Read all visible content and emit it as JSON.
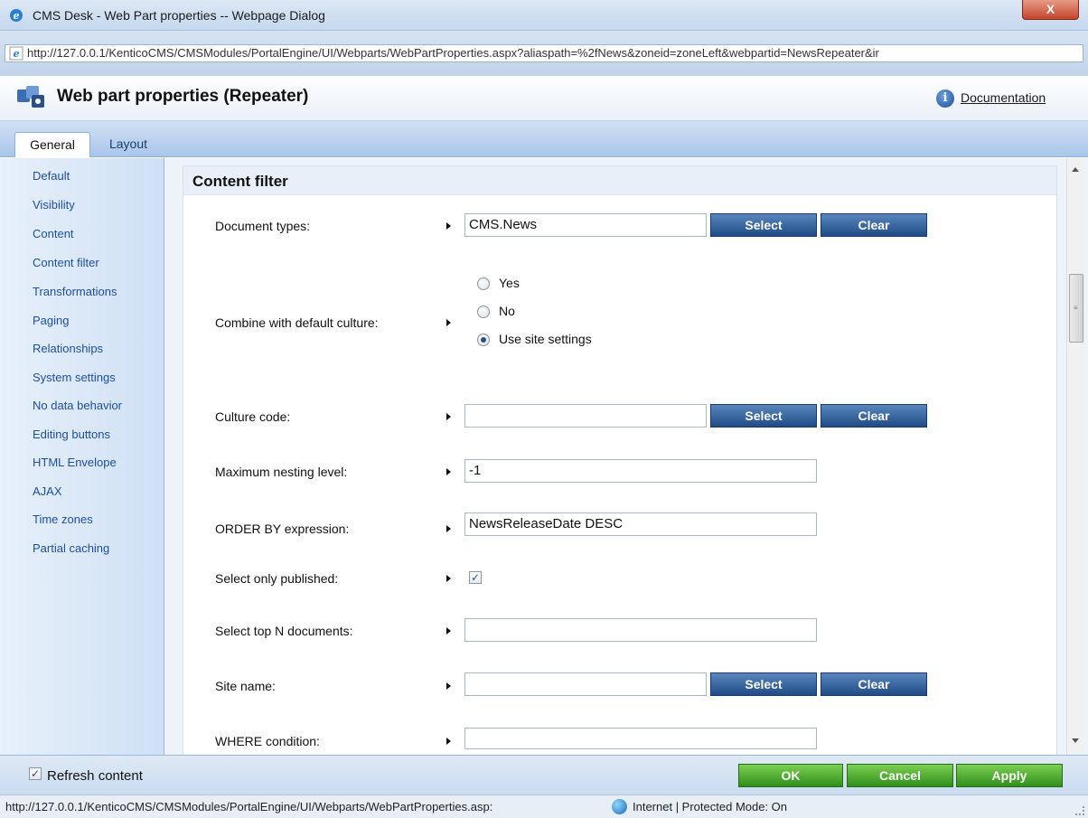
{
  "window": {
    "title": "CMS Desk - Web Part properties -- Webpage Dialog",
    "close_label": "X"
  },
  "address": {
    "url": "http://127.0.0.1/KenticoCMS/CMSModules/PortalEngine/UI/Webparts/WebPartProperties.aspx?aliaspath=%2fNews&zoneid=zoneLeft&webpartid=NewsRepeater&ir"
  },
  "header": {
    "title": "Web part properties (Repeater)",
    "doc_link": "Documentation",
    "info_glyph": "i"
  },
  "tabs": [
    {
      "label": "General",
      "active": true
    },
    {
      "label": "Layout",
      "active": false
    }
  ],
  "sidebar": {
    "items": [
      "Default",
      "Visibility",
      "Content",
      "Content filter",
      "Transformations",
      "Paging",
      "Relationships",
      "System settings",
      "No data behavior",
      "Editing buttons",
      "HTML Envelope",
      "AJAX",
      "Time zones",
      "Partial caching"
    ]
  },
  "section": {
    "title": "Content filter"
  },
  "form": {
    "document_types": {
      "label": "Document types:",
      "value": "CMS.News",
      "select_label": "Select",
      "clear_label": "Clear"
    },
    "combine_culture": {
      "label": "Combine with default culture:",
      "options": [
        "Yes",
        "No",
        "Use site settings"
      ],
      "selected": "Use site settings"
    },
    "culture_code": {
      "label": "Culture code:",
      "value": "",
      "select_label": "Select",
      "clear_label": "Clear"
    },
    "max_nesting": {
      "label": "Maximum nesting level:",
      "value": "-1"
    },
    "order_by": {
      "label": "ORDER BY expression:",
      "value": "NewsReleaseDate DESC"
    },
    "select_published": {
      "label": "Select only published:",
      "checked": true
    },
    "top_n": {
      "label": "Select top N documents:",
      "value": ""
    },
    "site_name": {
      "label": "Site name:",
      "value": "",
      "select_label": "Select",
      "clear_label": "Clear"
    },
    "where": {
      "label": "WHERE condition:",
      "value": ""
    }
  },
  "footer": {
    "refresh_label": "Refresh content",
    "refresh_checked": true,
    "ok_label": "OK",
    "cancel_label": "Cancel",
    "apply_label": "Apply"
  },
  "status": {
    "url": "http://127.0.0.1/KenticoCMS/CMSModules/PortalEngine/UI/Webparts/WebPartProperties.asp:",
    "zone": "Internet | Protected Mode: On"
  },
  "colors": {
    "blue_button": "#1f4c86",
    "green_button": "#2f8f1a",
    "link_blue": "#1d4fa0"
  }
}
